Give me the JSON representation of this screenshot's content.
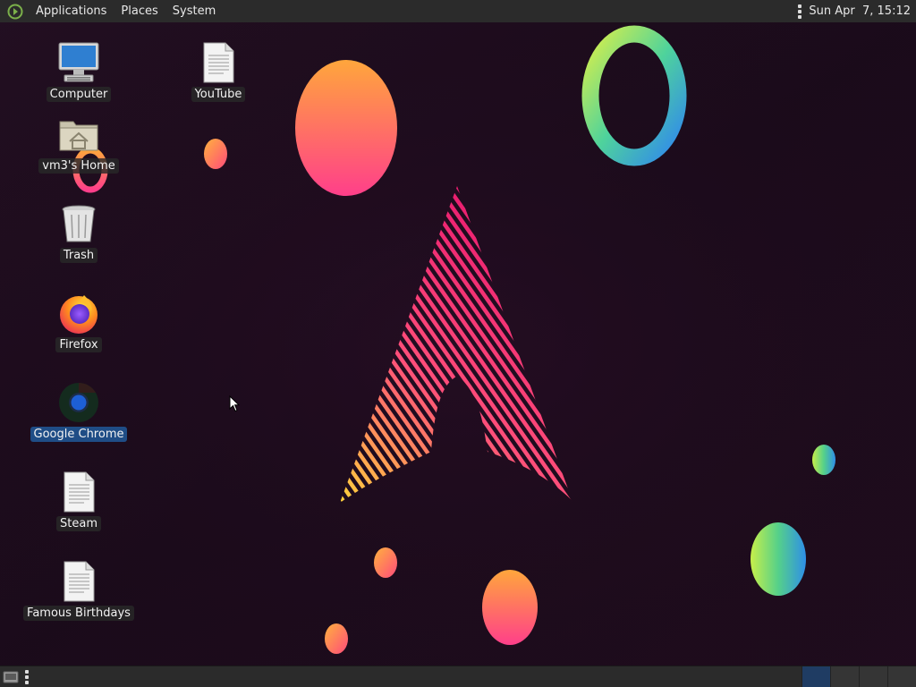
{
  "top_panel": {
    "menu": {
      "applications": "Applications",
      "places": "Places",
      "system": "System"
    },
    "clock": "Sun Apr  7, 15:12"
  },
  "desktop": {
    "icons": [
      {
        "label": "Computer",
        "icon": "computer-icon"
      },
      {
        "label": "YouTube",
        "icon": "text-file-icon"
      },
      {
        "label": "vm3's Home",
        "icon": "home-folder-icon"
      },
      {
        "label": "Trash",
        "icon": "trash-icon"
      },
      {
        "label": "Firefox",
        "icon": "firefox-icon"
      },
      {
        "label": "Google Chrome",
        "icon": "chrome-icon",
        "selected": true
      },
      {
        "label": "Steam",
        "icon": "text-file-icon"
      },
      {
        "label": "Famous Birthdays",
        "icon": "text-file-icon"
      }
    ]
  },
  "bottom_panel": {
    "workspaces": 4,
    "active_workspace": 1
  },
  "colors": {
    "panel": "#2b2b2b",
    "wallpaper_bg": "#1c0c1c",
    "selection": "#1f4d86"
  }
}
